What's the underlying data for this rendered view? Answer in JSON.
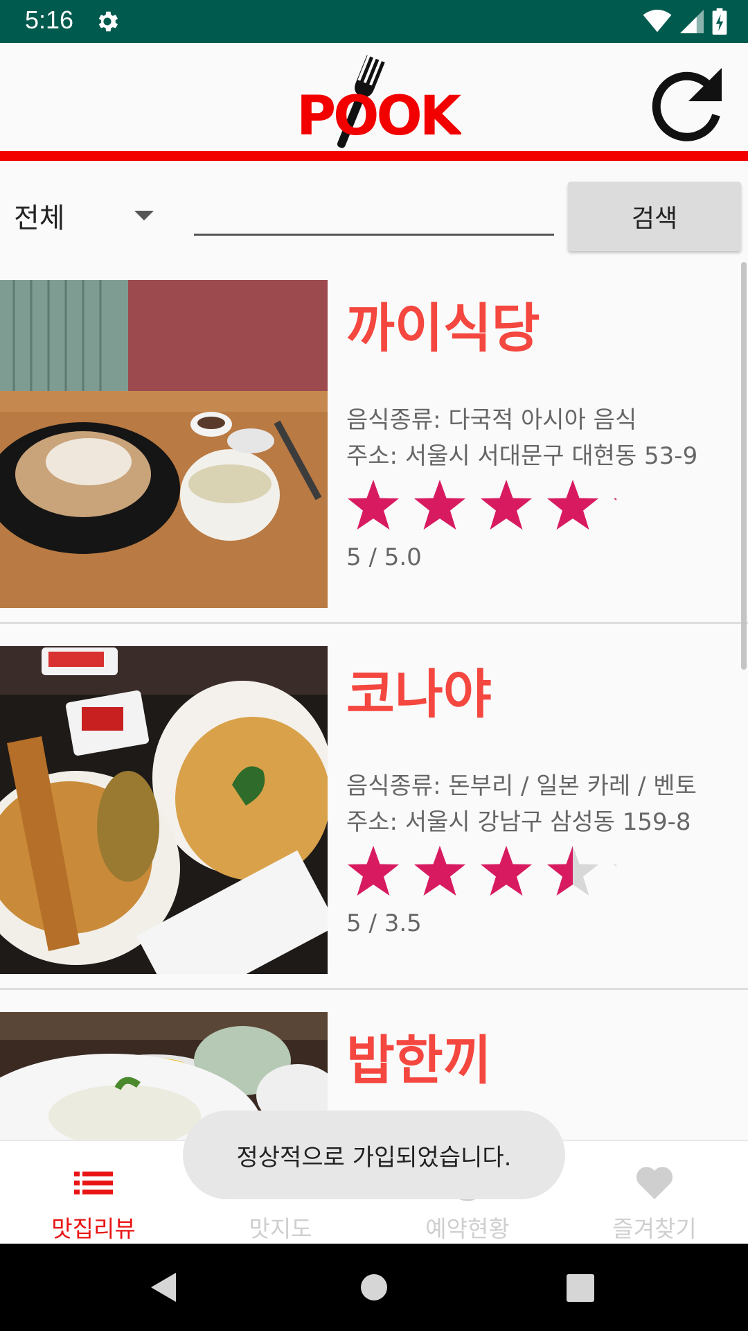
{
  "status_bar": {
    "time": "5:16",
    "settings_icon": "gear-icon",
    "icons": [
      "wifi-icon",
      "signal-icon",
      "battery-charging-icon"
    ],
    "background": "#005a4e"
  },
  "header": {
    "logo_text": "POOK",
    "logo_color": "#f20000",
    "refresh_icon": "refresh-icon",
    "accent_line_color": "#f20000"
  },
  "search": {
    "category_selected": "전체",
    "query_value": "",
    "query_placeholder": "",
    "button_label": "검색"
  },
  "restaurants": [
    {
      "name": "까이식당",
      "food_type": "음식종류: 다국적 아시아 음식",
      "address": "주소: 서울시 서대문구 대현동 53-9",
      "rating": 5.0,
      "rating_text": "5 / 5.0"
    },
    {
      "name": "코나야",
      "food_type": "음식종류: 돈부리 / 일본 카레 / 벤토",
      "address": "주소: 서울시 강남구 삼성동 159-8",
      "rating": 3.5,
      "rating_text": "5 / 3.5"
    },
    {
      "name": "밥한끼",
      "food_type": "",
      "address": "",
      "rating": null,
      "rating_text": ""
    }
  ],
  "rating_colors": {
    "filled": "#d81b60",
    "empty": "#d8d8d8"
  },
  "toast": {
    "message": "정상적으로 가입되었습니다."
  },
  "bottom_nav": {
    "items": [
      {
        "label": "맛집리뷰",
        "icon": "list-icon",
        "active": true
      },
      {
        "label": "맛지도",
        "icon": "map-icon",
        "active": false
      },
      {
        "label": "예약현황",
        "icon": "clock-icon",
        "active": false
      },
      {
        "label": "즐겨찾기",
        "icon": "heart-icon",
        "active": false
      }
    ],
    "active_color": "#e81414",
    "inactive_color": "#cfcfcf"
  },
  "system_nav": {
    "buttons": [
      "back-icon",
      "home-icon",
      "recents-icon"
    ]
  }
}
